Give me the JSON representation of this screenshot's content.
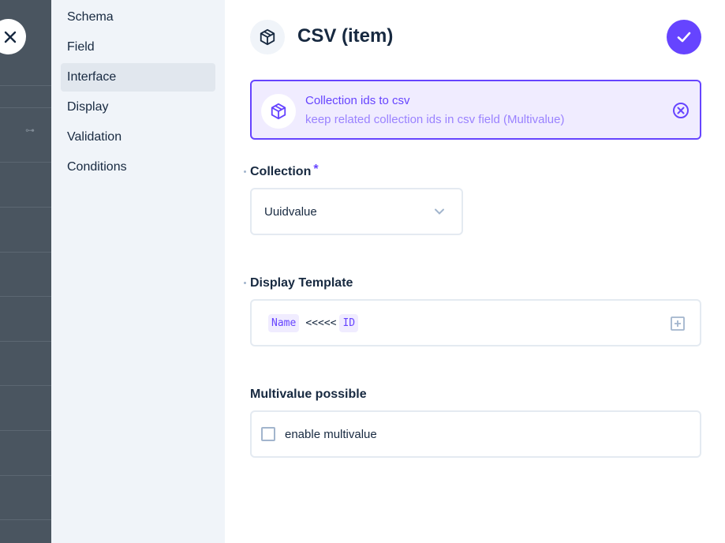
{
  "sidebar": {
    "items": [
      {
        "label": "Schema"
      },
      {
        "label": "Field"
      },
      {
        "label": "Interface"
      },
      {
        "label": "Display"
      },
      {
        "label": "Validation"
      },
      {
        "label": "Conditions"
      }
    ],
    "active": "Interface"
  },
  "header": {
    "title": "CSV (item)",
    "icon": "box-icon",
    "save_icon": "check-icon"
  },
  "notice": {
    "title": "Collection ids to csv",
    "subtitle": "keep related collection ids in csv field (Multivalue)",
    "icon": "box-icon",
    "close_icon": "close-circle-icon"
  },
  "collection": {
    "label": "Collection",
    "required_mark": "*",
    "value": "Uuidvalue"
  },
  "display_template": {
    "label": "Display Template",
    "chip1": "Name",
    "separator": "<<<<<",
    "chip2": "ID"
  },
  "multivalue": {
    "label": "Multivalue possible",
    "checkbox_label": "enable multivalue",
    "checked": false
  },
  "colors": {
    "primary": "#6644ff",
    "primary_soft": "#f0ecff",
    "sidebar_bg": "#f0f4f9",
    "text": "#172940",
    "border": "#e4eaf1"
  }
}
